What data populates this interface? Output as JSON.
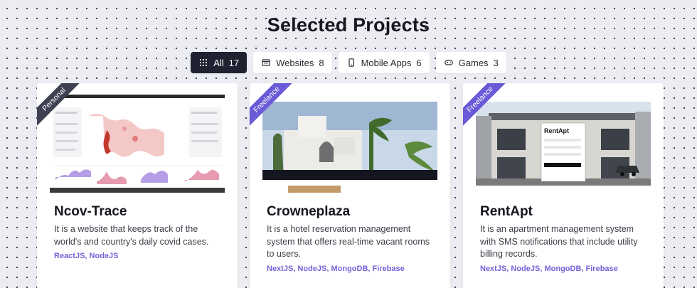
{
  "page": {
    "title": "Selected Projects"
  },
  "filters": [
    {
      "label": "All",
      "count": "17",
      "icon": "grid-icon",
      "active": true
    },
    {
      "label": "Websites",
      "count": "8",
      "icon": "browser-window-icon",
      "active": false
    },
    {
      "label": "Mobile Apps",
      "count": "6",
      "icon": "smartphone-icon",
      "active": false
    },
    {
      "label": "Games",
      "count": "3",
      "icon": "gamepad-icon",
      "active": false
    }
  ],
  "projects": [
    {
      "ribbon": "Personal",
      "title": "Ncov-Trace",
      "description": "It is a website that keeps track of the world's and country's daily covid cases.",
      "tags": "ReactJS, NodeJS"
    },
    {
      "ribbon": "Freelance",
      "title": "Crowneplaza",
      "description": "It is a hotel reservation management system that offers real-time vacant rooms to users.",
      "tags": "NextJS, NodeJS, MongoDB, Firebase"
    },
    {
      "ribbon": "Freelance",
      "title": "RentApt",
      "description": "It is an apartment management system with SMS notifications that include utility billing records.",
      "tags": "NextJS, NodeJS, MongoDB, Firebase",
      "screenshot_brand": "RentApt"
    }
  ],
  "colors": {
    "accent": "#7463d8",
    "dark": "#1f2230",
    "ribbon_personal": "#3d4152",
    "ribbon_freelance": "#6a5ad8"
  }
}
